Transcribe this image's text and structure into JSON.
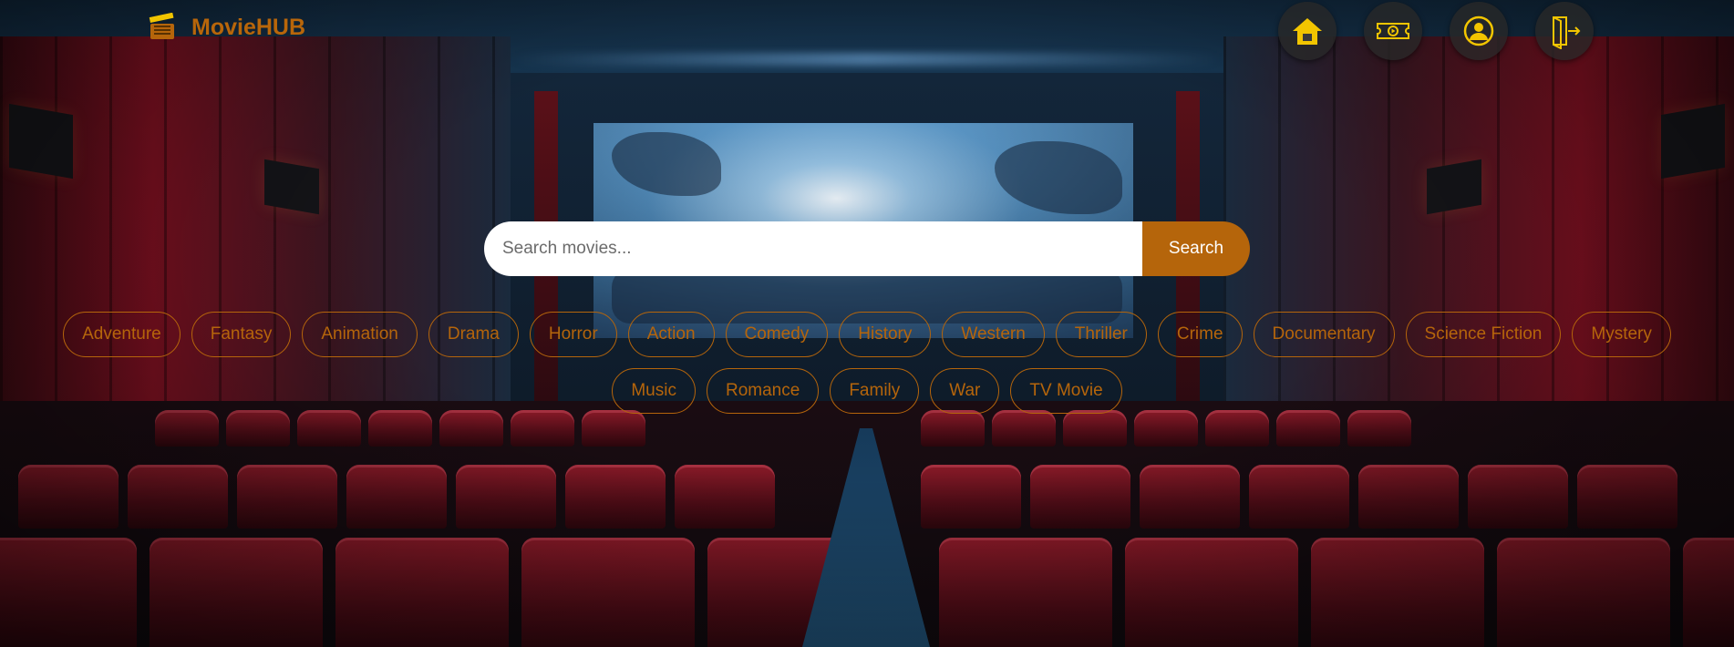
{
  "header": {
    "app_title": "MovieHUB"
  },
  "nav": {
    "items": [
      {
        "icon": "home-icon"
      },
      {
        "icon": "ticket-icon"
      },
      {
        "icon": "user-profile-icon"
      },
      {
        "icon": "logout-icon"
      }
    ]
  },
  "search": {
    "placeholder": "Search movies...",
    "value": "",
    "button_label": "Search"
  },
  "genres": [
    "Adventure",
    "Fantasy",
    "Animation",
    "Drama",
    "Horror",
    "Action",
    "Comedy",
    "History",
    "Western",
    "Thriller",
    "Crime",
    "Documentary",
    "Science Fiction",
    "Mystery",
    "Music",
    "Romance",
    "Family",
    "War",
    "TV Movie"
  ],
  "colors": {
    "accent": "#b5650b",
    "nav_icon": "#f2c500",
    "nav_button_bg": "#282828"
  }
}
